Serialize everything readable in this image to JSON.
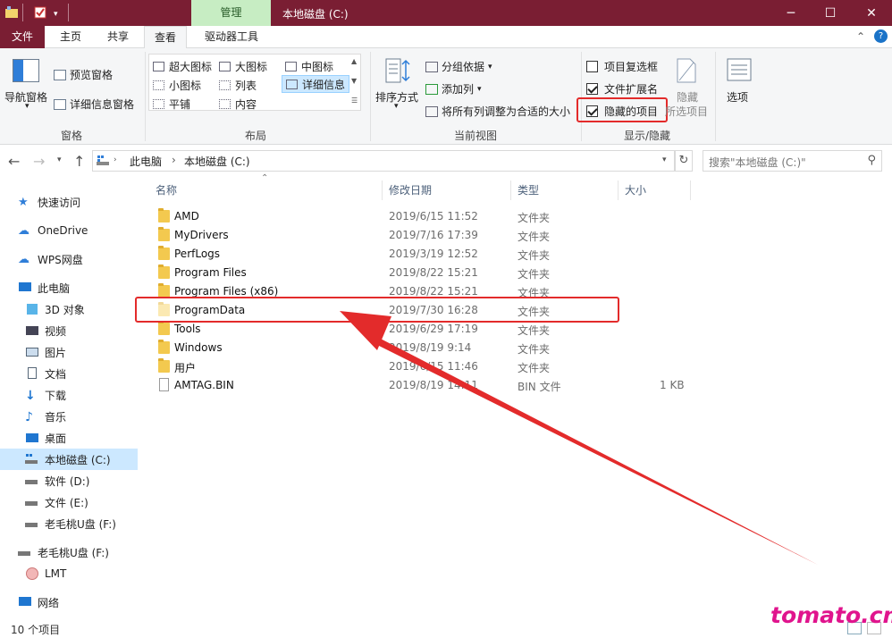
{
  "window": {
    "context_tab": "管理",
    "title": "本地磁盘 (C:)",
    "controls": {
      "minimize": "─",
      "maximize": "☐",
      "close": "✕"
    }
  },
  "ribbon_tabs": [
    "文件",
    "主页",
    "共享",
    "查看",
    "驱动器工具"
  ],
  "ribbon": {
    "panes": {
      "nav_pane": "导航窗格",
      "preview_pane": "预览窗格",
      "details_pane": "详细信息窗格",
      "group_label": "窗格"
    },
    "layout": {
      "items": [
        "超大图标",
        "大图标",
        "中图标",
        "小图标",
        "列表",
        "详细信息",
        "平铺",
        "内容"
      ],
      "selected": "详细信息",
      "group_label": "布局"
    },
    "current_view": {
      "sort_by": "排序方式",
      "group_by": "分组依据",
      "add_columns": "添加列",
      "size_all_columns": "将所有列调整为合适的大小",
      "group_label": "当前视图"
    },
    "show_hide": {
      "item_check_boxes": {
        "label": "项目复选框",
        "checked": false
      },
      "file_name_extensions": {
        "label": "文件扩展名",
        "checked": true
      },
      "hidden_items": {
        "label": "隐藏的项目",
        "checked": true
      },
      "hide_selected_1": "隐藏",
      "hide_selected_2": "所选项目",
      "options": "选项",
      "group_label": "显示/隐藏"
    }
  },
  "address": {
    "path": [
      "此电脑",
      "本地磁盘 (C:)"
    ],
    "search_placeholder": "搜索\"本地磁盘 (C:)\""
  },
  "nav": {
    "items": [
      {
        "label": "快速访问",
        "icon": "star-icon"
      },
      {
        "label": "OneDrive",
        "icon": "cloud-icon"
      },
      {
        "label": "WPS网盘",
        "icon": "wps-cloud-icon"
      },
      {
        "label": "此电脑",
        "icon": "computer-icon"
      },
      {
        "label": "3D 对象",
        "icon": "cube-icon"
      },
      {
        "label": "视频",
        "icon": "video-icon"
      },
      {
        "label": "图片",
        "icon": "picture-icon"
      },
      {
        "label": "文档",
        "icon": "document-icon"
      },
      {
        "label": "下载",
        "icon": "download-icon"
      },
      {
        "label": "音乐",
        "icon": "music-icon"
      },
      {
        "label": "桌面",
        "icon": "desktop-icon"
      },
      {
        "label": "本地磁盘 (C:)",
        "icon": "drive-c-icon"
      },
      {
        "label": "软件 (D:)",
        "icon": "drive-icon"
      },
      {
        "label": "文件 (E:)",
        "icon": "drive-icon"
      },
      {
        "label": "老毛桃U盘 (F:)",
        "icon": "usb-drive-icon"
      },
      {
        "label": "老毛桃U盘 (F:)",
        "icon": "usb-drive-icon"
      },
      {
        "label": "LMT",
        "icon": "folder-lmt-icon"
      },
      {
        "label": "网络",
        "icon": "network-icon"
      }
    ],
    "selected": "本地磁盘 (C:)"
  },
  "columns": [
    "名称",
    "修改日期",
    "类型",
    "大小"
  ],
  "files": [
    {
      "name": "AMD",
      "date": "2019/6/15 11:52",
      "type": "文件夹",
      "size": ""
    },
    {
      "name": "MyDrivers",
      "date": "2019/7/16 17:39",
      "type": "文件夹",
      "size": ""
    },
    {
      "name": "PerfLogs",
      "date": "2019/3/19 12:52",
      "type": "文件夹",
      "size": ""
    },
    {
      "name": "Program Files",
      "date": "2019/8/22 15:21",
      "type": "文件夹",
      "size": ""
    },
    {
      "name": "Program Files (x86)",
      "date": "2019/8/22 15:21",
      "type": "文件夹",
      "size": ""
    },
    {
      "name": "ProgramData",
      "date": "2019/7/30 16:28",
      "type": "文件夹",
      "size": ""
    },
    {
      "name": "Tools",
      "date": "2019/6/29 17:19",
      "type": "文件夹",
      "size": ""
    },
    {
      "name": "Windows",
      "date": "2019/8/19 9:14",
      "type": "文件夹",
      "size": ""
    },
    {
      "name": "用户",
      "date": "2019/6/15 11:46",
      "type": "文件夹",
      "size": ""
    },
    {
      "name": "AMTAG.BIN",
      "date": "2019/8/19 14:11",
      "type": "BIN 文件",
      "size": "1 KB"
    }
  ],
  "status": {
    "count": "10 个项目"
  },
  "watermark": "tomato.cm",
  "colors": {
    "titlebar": "#7a1e33",
    "accent": "#e32b2b",
    "file_tab": "#7a1e33",
    "manage_tab": "#c7edc3"
  }
}
